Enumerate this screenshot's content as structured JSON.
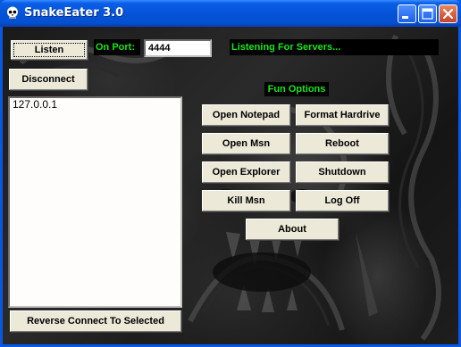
{
  "window": {
    "title": "SnakeEater 3.0",
    "icons": {
      "app": "skull-icon",
      "minimize": "minimize-icon",
      "maximize": "maximize-icon",
      "close": "close-icon"
    }
  },
  "server": {
    "listen_label": "Listen",
    "disconnect_label": "Disconnect",
    "port_label": "On Port:",
    "port_value": "4444",
    "status_text": "Listening For Servers..."
  },
  "clients": {
    "items": [
      "127.0.0.1"
    ],
    "reverse_connect_label": "Reverse Connect To Selected"
  },
  "fun_options": {
    "heading": "Fun Options",
    "open_notepad": "Open Notepad",
    "format_hardrive": "Format Hardrive",
    "open_msn": "Open Msn",
    "reboot": "Reboot",
    "open_explorer": "Open Explorer",
    "shutdown": "Shutdown",
    "kill_msn": "Kill Msn",
    "log_off": "Log Off",
    "about": "About"
  },
  "colors": {
    "status_green": "#19e619",
    "button_face": "#ece9d8",
    "titlebar_blue": "#0553d8"
  }
}
